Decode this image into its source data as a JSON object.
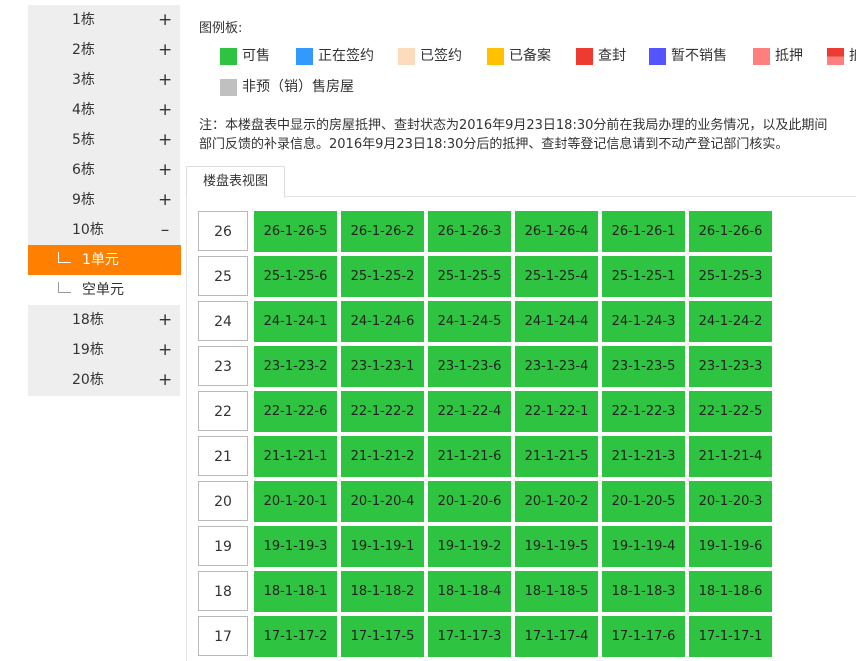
{
  "sidebar": {
    "items": [
      {
        "label": "1栋",
        "toggle": "+"
      },
      {
        "label": "2栋",
        "toggle": "+"
      },
      {
        "label": "3栋",
        "toggle": "+"
      },
      {
        "label": "4栋",
        "toggle": "+"
      },
      {
        "label": "5栋",
        "toggle": "+"
      },
      {
        "label": "6栋",
        "toggle": "+"
      },
      {
        "label": "9栋",
        "toggle": "+"
      },
      {
        "label": "10栋",
        "toggle": "–"
      },
      {
        "label": "1单元",
        "toggle": ""
      },
      {
        "label": "空单元",
        "toggle": ""
      },
      {
        "label": "18栋",
        "toggle": "+"
      },
      {
        "label": "19栋",
        "toggle": "+"
      },
      {
        "label": "20栋",
        "toggle": "+"
      }
    ]
  },
  "legend": {
    "title": "图例板:",
    "items": [
      {
        "label": "可售",
        "color": "#2ec441"
      },
      {
        "label": "正在签约",
        "color": "#3399ff"
      },
      {
        "label": "已签约",
        "color": "#fcdcbd"
      },
      {
        "label": "已备案",
        "color": "#ffc000"
      },
      {
        "label": "查封",
        "color": "#ee3b32"
      },
      {
        "label": "暂不销售",
        "color": "#5555ff"
      },
      {
        "label": "抵押",
        "color": "#ff7f7f"
      },
      {
        "label": "抵",
        "color": "#ee3b32"
      },
      {
        "label": "非预（销）售房屋",
        "color": "#c0c0c0"
      }
    ]
  },
  "notice": {
    "line1": "注：本楼盘表中显示的房屋抵押、查封状态为2016年9月23日18:30分前在我局办理的业务情况，以及此期间",
    "line2": "部门反馈的补录信息。2016年9月23日18:30分后的抵押、查封等登记信息请到不动产登记部门核实。"
  },
  "tab": {
    "label": "楼盘表视图"
  },
  "floors": [
    {
      "floor": "26",
      "units": [
        "26-1-26-5",
        "26-1-26-2",
        "26-1-26-3",
        "26-1-26-4",
        "26-1-26-1",
        "26-1-26-6"
      ]
    },
    {
      "floor": "25",
      "units": [
        "25-1-25-6",
        "25-1-25-2",
        "25-1-25-5",
        "25-1-25-4",
        "25-1-25-1",
        "25-1-25-3"
      ]
    },
    {
      "floor": "24",
      "units": [
        "24-1-24-1",
        "24-1-24-6",
        "24-1-24-5",
        "24-1-24-4",
        "24-1-24-3",
        "24-1-24-2"
      ]
    },
    {
      "floor": "23",
      "units": [
        "23-1-23-2",
        "23-1-23-1",
        "23-1-23-6",
        "23-1-23-4",
        "23-1-23-5",
        "23-1-23-3"
      ]
    },
    {
      "floor": "22",
      "units": [
        "22-1-22-6",
        "22-1-22-2",
        "22-1-22-4",
        "22-1-22-1",
        "22-1-22-3",
        "22-1-22-5"
      ]
    },
    {
      "floor": "21",
      "units": [
        "21-1-21-1",
        "21-1-21-2",
        "21-1-21-6",
        "21-1-21-5",
        "21-1-21-3",
        "21-1-21-4"
      ]
    },
    {
      "floor": "20",
      "units": [
        "20-1-20-1",
        "20-1-20-4",
        "20-1-20-6",
        "20-1-20-2",
        "20-1-20-5",
        "20-1-20-3"
      ]
    },
    {
      "floor": "19",
      "units": [
        "19-1-19-3",
        "19-1-19-1",
        "19-1-19-2",
        "19-1-19-5",
        "19-1-19-4",
        "19-1-19-6"
      ]
    },
    {
      "floor": "18",
      "units": [
        "18-1-18-1",
        "18-1-18-2",
        "18-1-18-4",
        "18-1-18-5",
        "18-1-18-3",
        "18-1-18-6"
      ]
    },
    {
      "floor": "17",
      "units": [
        "17-1-17-2",
        "17-1-17-5",
        "17-1-17-3",
        "17-1-17-4",
        "17-1-17-6",
        "17-1-17-1"
      ]
    }
  ]
}
